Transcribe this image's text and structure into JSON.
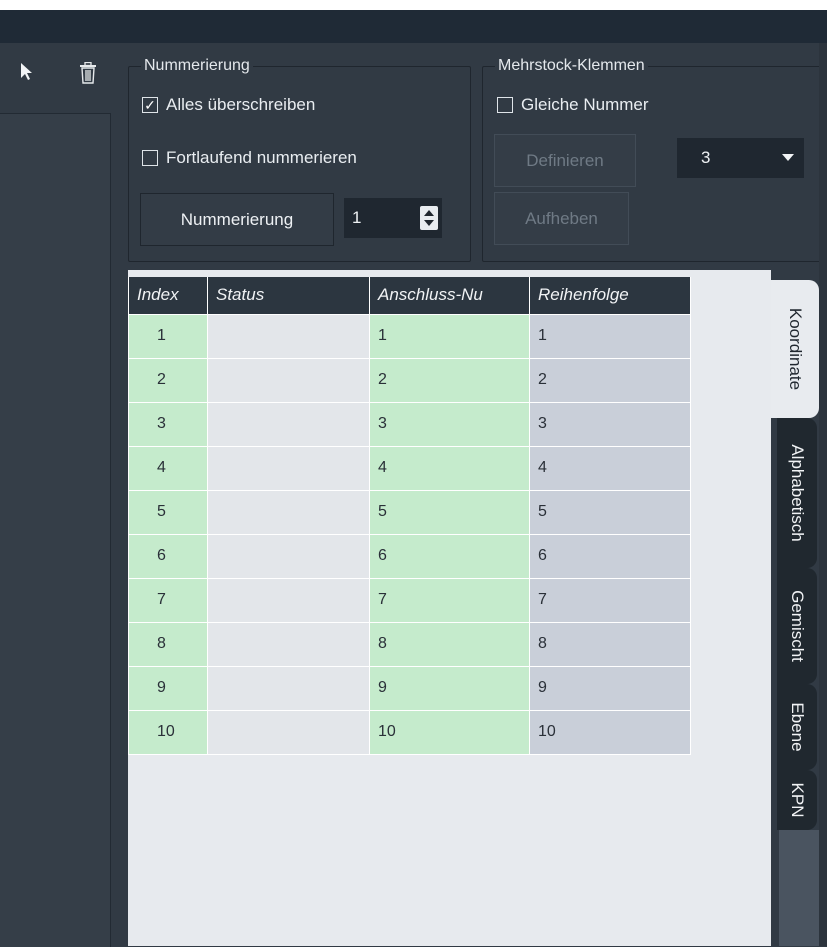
{
  "toolbar": {
    "pointer_icon": "cursor-arrow-icon",
    "delete_icon": "trash-icon"
  },
  "numbering": {
    "title": "Nummerierung",
    "overwrite_all": {
      "label": "Alles überschreiben",
      "checked": true
    },
    "continuous": {
      "label": "Fortlaufend nummerieren",
      "checked": false
    },
    "button": "Nummerierung",
    "start_value": "1"
  },
  "multilevel": {
    "title": "Mehrstock-Klemmen",
    "same_number": {
      "label": "Gleiche Nummer",
      "checked": false
    },
    "define_button": "Definieren",
    "cancel_button": "Aufheben",
    "levels_value": "3"
  },
  "table": {
    "headers": [
      "Index",
      "Status",
      "Anschluss-Nu",
      "Reihenfolge"
    ],
    "rows": [
      [
        "1",
        "",
        "1",
        "1"
      ],
      [
        "2",
        "",
        "2",
        "2"
      ],
      [
        "3",
        "",
        "3",
        "3"
      ],
      [
        "4",
        "",
        "4",
        "4"
      ],
      [
        "5",
        "",
        "5",
        "5"
      ],
      [
        "6",
        "",
        "6",
        "6"
      ],
      [
        "7",
        "",
        "7",
        "7"
      ],
      [
        "8",
        "",
        "8",
        "8"
      ],
      [
        "9",
        "",
        "9",
        "9"
      ],
      [
        "10",
        "",
        "10",
        "10"
      ]
    ]
  },
  "tabs": [
    "Koordinate",
    "Alphabetisch",
    "Gemischt",
    "Ebene",
    "KPN"
  ],
  "colors": {
    "panel": "#313a44",
    "green_cell": "#c5ebcc",
    "blue_cell": "#c9cfd9",
    "header": "#2c3640"
  }
}
